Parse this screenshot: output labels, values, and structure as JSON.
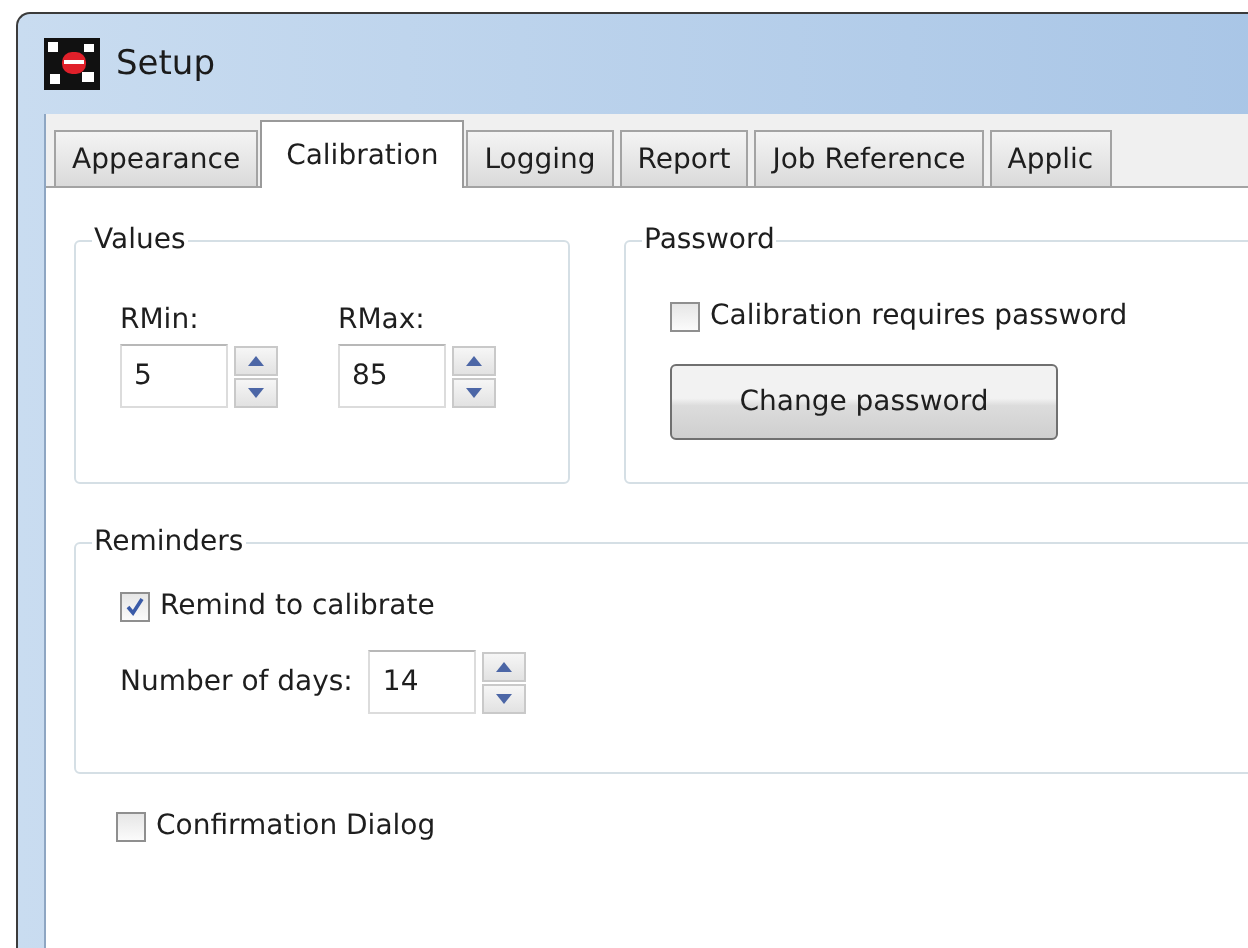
{
  "window": {
    "title": "Setup"
  },
  "tabs": [
    {
      "label": "Appearance",
      "selected": false
    },
    {
      "label": "Calibration",
      "selected": true
    },
    {
      "label": "Logging",
      "selected": false
    },
    {
      "label": "Report",
      "selected": false
    },
    {
      "label": "Job Reference",
      "selected": false
    },
    {
      "label": "Applic",
      "selected": false
    }
  ],
  "values_group": {
    "title": "Values",
    "fields": [
      {
        "label": "RMin:",
        "value": "5"
      },
      {
        "label": "RMax:",
        "value": "85"
      }
    ]
  },
  "password_group": {
    "title": "Password",
    "checkbox": {
      "label": "Calibration requires password",
      "checked": false
    },
    "button": "Change password"
  },
  "reminders_group": {
    "title": "Reminders",
    "checkbox": {
      "label": "Remind to calibrate",
      "checked": true
    },
    "days": {
      "label": "Number of days:",
      "value": "14"
    }
  },
  "confirmation_dialog": {
    "label": "Confirmation Dialog",
    "checked": false
  }
}
